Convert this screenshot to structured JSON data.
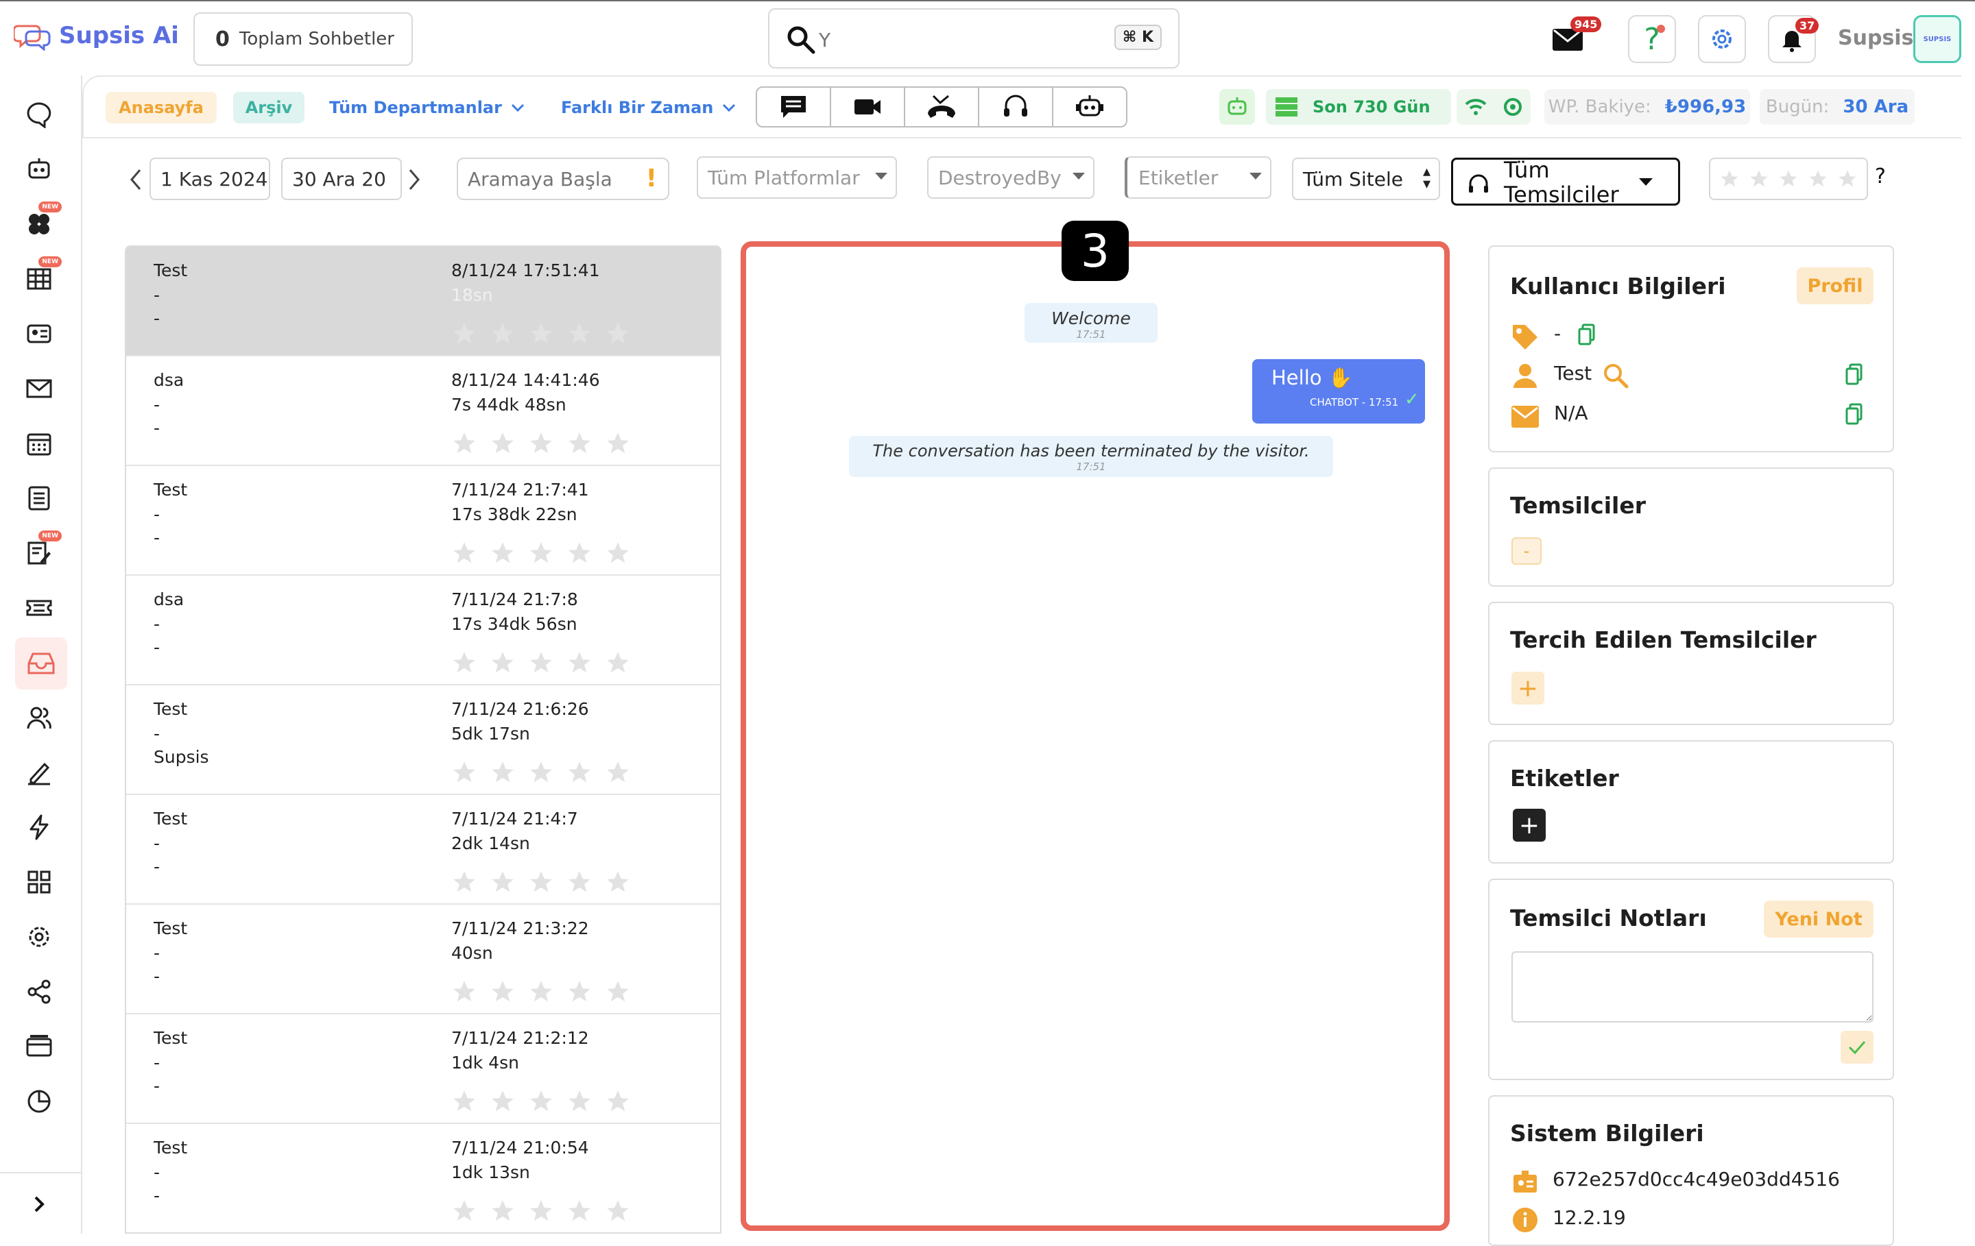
{
  "app": {
    "name": "Supsis Ai"
  },
  "header": {
    "total_count": "0",
    "total_label": "Toplam Sohbetler",
    "search_placeholder": "Y",
    "search_shortcut": "⌘ K",
    "mail_badge": "945",
    "bell_badge": "37",
    "user_name": "Supsis",
    "avatar_label": "SUPSIS"
  },
  "sidebar": {
    "new_label": "NEW"
  },
  "nav": {
    "home": "Anasayfa",
    "archive": "Arşiv",
    "departments": "Tüm Departmanlar",
    "time": "Farklı Bir Zaman",
    "days": "Son 730 Gün",
    "balance_label": "WP. Bakiye:",
    "balance_value": "₺996,93",
    "today_label": "Bugün:",
    "today_value": "30 Ara"
  },
  "filters": {
    "date_start": "1 Kas 2024",
    "date_end": "30 Ara 20",
    "search_placeholder": "Aramaya Başla",
    "platforms": "Tüm Platformlar",
    "destroyed": "DestroyedBy",
    "tags": "Etiketler",
    "sites": "Tüm Sitele",
    "agents_line1": "Tüm",
    "agents_line2": "Temsilciler",
    "rating_help": "?"
  },
  "conversations": [
    {
      "name": "Test",
      "line2": "-",
      "line3": "-",
      "date": "8/11/24 17:51:41",
      "duration": "18sn",
      "selected": true
    },
    {
      "name": "dsa",
      "line2": "-",
      "line3": "-",
      "date": "8/11/24 14:41:46",
      "duration": "7s 44dk 48sn"
    },
    {
      "name": "Test",
      "line2": "-",
      "line3": "-",
      "date": "7/11/24 21:7:41",
      "duration": "17s 38dk 22sn"
    },
    {
      "name": "dsa",
      "line2": "-",
      "line3": "-",
      "date": "7/11/24 21:7:8",
      "duration": "17s 34dk 56sn"
    },
    {
      "name": "Test",
      "line2": "-",
      "line3": "Supsis",
      "date": "7/11/24 21:6:26",
      "duration": "5dk 17sn"
    },
    {
      "name": "Test",
      "line2": "-",
      "line3": "-",
      "date": "7/11/24 21:4:7",
      "duration": "2dk 14sn"
    },
    {
      "name": "Test",
      "line2": "-",
      "line3": "-",
      "date": "7/11/24 21:3:22",
      "duration": "40sn"
    },
    {
      "name": "Test",
      "line2": "-",
      "line3": "-",
      "date": "7/11/24 21:2:12",
      "duration": "1dk 4sn"
    },
    {
      "name": "Test",
      "line2": "-",
      "line3": "-",
      "date": "7/11/24 21:0:54",
      "duration": "1dk 13sn"
    }
  ],
  "chat": {
    "step_number": "3",
    "welcome": "Welcome",
    "welcome_time": "17:51",
    "hello": "Hello ✋",
    "hello_meta": "CHATBOT - 17:51",
    "terminated": "The conversation has been terminated by the visitor.",
    "terminated_time": "17:51"
  },
  "user_info": {
    "title": "Kullanıcı Bilgileri",
    "profile_btn": "Profil",
    "tag_value": "-",
    "name_value": "Test",
    "email_value": "N/A"
  },
  "agents": {
    "title": "Temsilciler",
    "placeholder": "-"
  },
  "preferred_agents": {
    "title": "Tercih Edilen Temsilciler",
    "add": "+"
  },
  "tags_card": {
    "title": "Etiketler",
    "add": "+"
  },
  "notes": {
    "title": "Temsilci Notları",
    "new_btn": "Yeni Not"
  },
  "system": {
    "title": "Sistem Bilgileri",
    "id": "672e257d0cc4c49e03dd4516",
    "version": "12.2.19"
  },
  "colors": {
    "accent": "#5b6ee1",
    "orange": "#f0a431",
    "red": "#e8685c",
    "green": "#23a455"
  }
}
